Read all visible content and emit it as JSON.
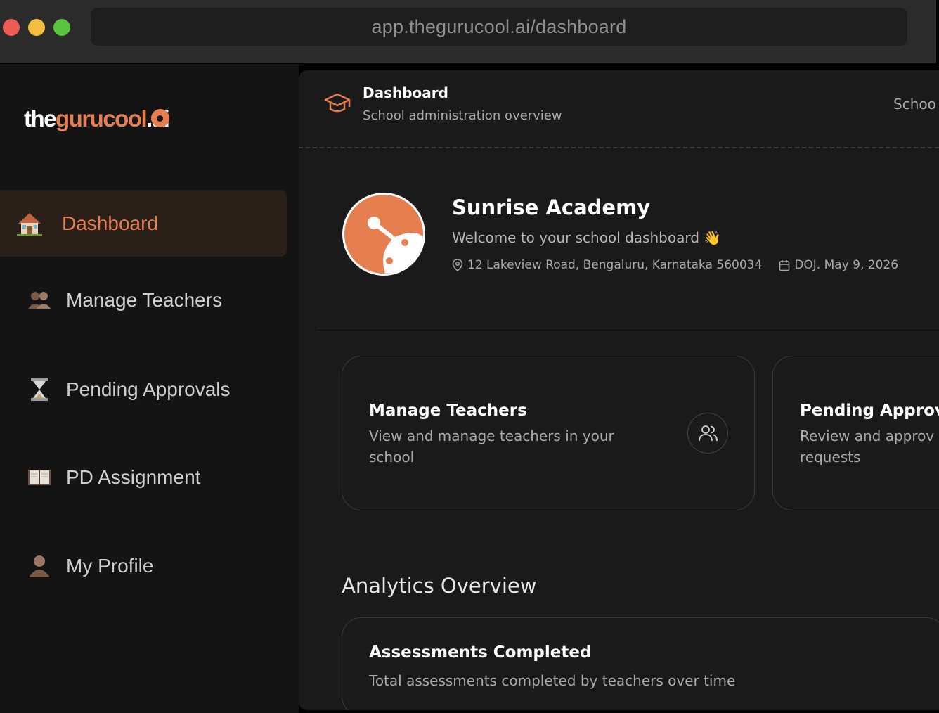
{
  "browser": {
    "url": "app.thegurucool.ai/dashboard"
  },
  "logo": {
    "part1": "the",
    "part2": "gurucool",
    "part3": ".ai"
  },
  "sidebar": {
    "items": [
      {
        "label": "Dashboard",
        "icon": "house-icon",
        "active": true
      },
      {
        "label": "Manage Teachers",
        "icon": "people-icon",
        "active": false
      },
      {
        "label": "Pending Approvals",
        "icon": "hourglass-icon",
        "active": false
      },
      {
        "label": "PD Assignment",
        "icon": "book-icon",
        "active": false
      },
      {
        "label": "My Profile",
        "icon": "person-icon",
        "active": false
      }
    ]
  },
  "header": {
    "title": "Dashboard",
    "subtitle": "School administration overview",
    "right_text": "Schoo"
  },
  "school": {
    "name": "Sunrise Academy",
    "welcome": "Welcome to your school dashboard 👋",
    "address": "12 Lakeview Road, Bengaluru, Karnataka 560034",
    "doj": "DOJ. May 9, 2026"
  },
  "cards": [
    {
      "title": "Manage Teachers",
      "description": "View and manage teachers in your school"
    },
    {
      "title": "Pending Approv",
      "description": "Review and approv requests"
    }
  ],
  "analytics": {
    "section_title": "Analytics Overview",
    "panel_title": "Assessments Completed",
    "panel_subtitle": "Total assessments completed by teachers over time"
  },
  "colors": {
    "accent": "#e57f50",
    "background": "#141414",
    "panel": "#1a1a1a"
  }
}
